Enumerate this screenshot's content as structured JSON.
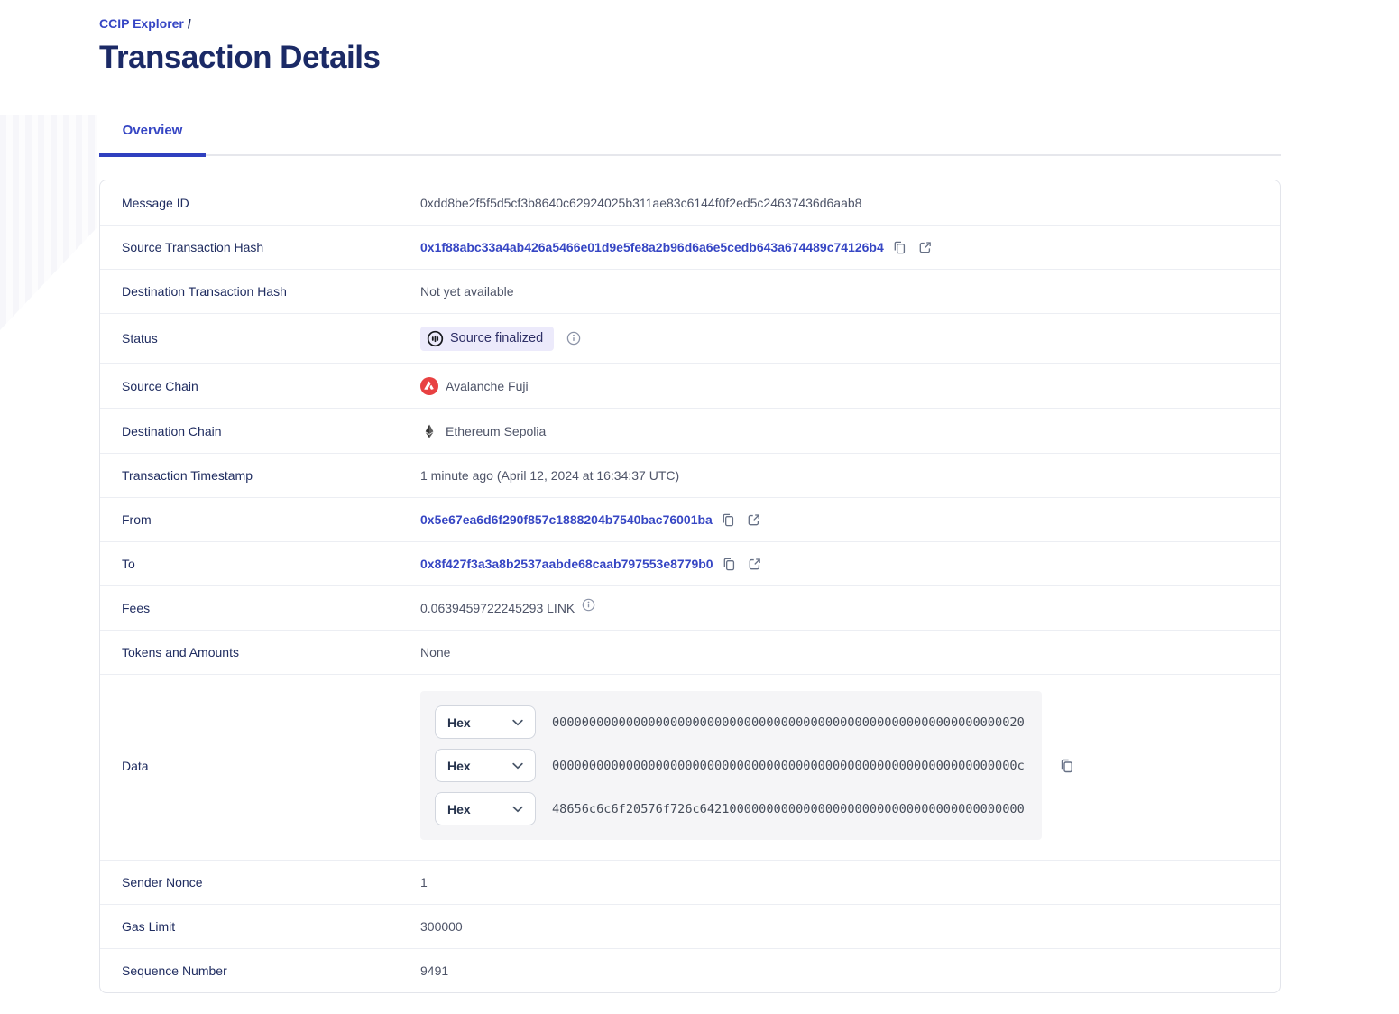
{
  "colors": {
    "accent_blue": "#3646c4",
    "title_navy": "#1b2a66",
    "badge_bg": "#eceafb",
    "avalanche_red": "#e84142",
    "ethereum_dark": "#343434",
    "data_box_bg": "#f5f5f7"
  },
  "breadcrumb": {
    "parent": "CCIP Explorer",
    "separator": "/"
  },
  "title": "Transaction Details",
  "tabs": {
    "overview": "Overview"
  },
  "rows": {
    "message_id": {
      "label": "Message ID",
      "value": "0xdd8be2f5f5d5cf3b8640c62924025b311ae83c6144f0f2ed5c24637436d6aab8"
    },
    "source_tx": {
      "label": "Source Transaction Hash",
      "value": "0x1f88abc33a4ab426a5466e01d9e5fe8a2b96d6a6e5cedb643a674489c74126b4"
    },
    "dest_tx": {
      "label": "Destination Transaction Hash",
      "value": "Not yet available"
    },
    "status": {
      "label": "Status",
      "value": "Source finalized"
    },
    "source_chain": {
      "label": "Source Chain",
      "value": "Avalanche Fuji"
    },
    "dest_chain": {
      "label": "Destination Chain",
      "value": "Ethereum Sepolia"
    },
    "timestamp": {
      "label": "Transaction Timestamp",
      "value": "1 minute ago (April 12, 2024 at 16:34:37 UTC)"
    },
    "from": {
      "label": "From",
      "value": "0x5e67ea6d6f290f857c1888204b7540bac76001ba"
    },
    "to": {
      "label": "To",
      "value": "0x8f427f3a3a8b2537aabde68caab797553e8779b0"
    },
    "fees": {
      "label": "Fees",
      "value": "0.0639459722245293 LINK"
    },
    "tokens": {
      "label": "Tokens and Amounts",
      "value": "None"
    },
    "data": {
      "label": "Data",
      "entries": [
        {
          "format": "Hex",
          "value": "0000000000000000000000000000000000000000000000000000000000000020"
        },
        {
          "format": "Hex",
          "value": "000000000000000000000000000000000000000000000000000000000000000c"
        },
        {
          "format": "Hex",
          "value": "48656c6c6f20576f726c64210000000000000000000000000000000000000000"
        }
      ]
    },
    "sender_nonce": {
      "label": "Sender Nonce",
      "value": "1"
    },
    "gas_limit": {
      "label": "Gas Limit",
      "value": "300000"
    },
    "sequence": {
      "label": "Sequence Number",
      "value": "9491"
    }
  }
}
